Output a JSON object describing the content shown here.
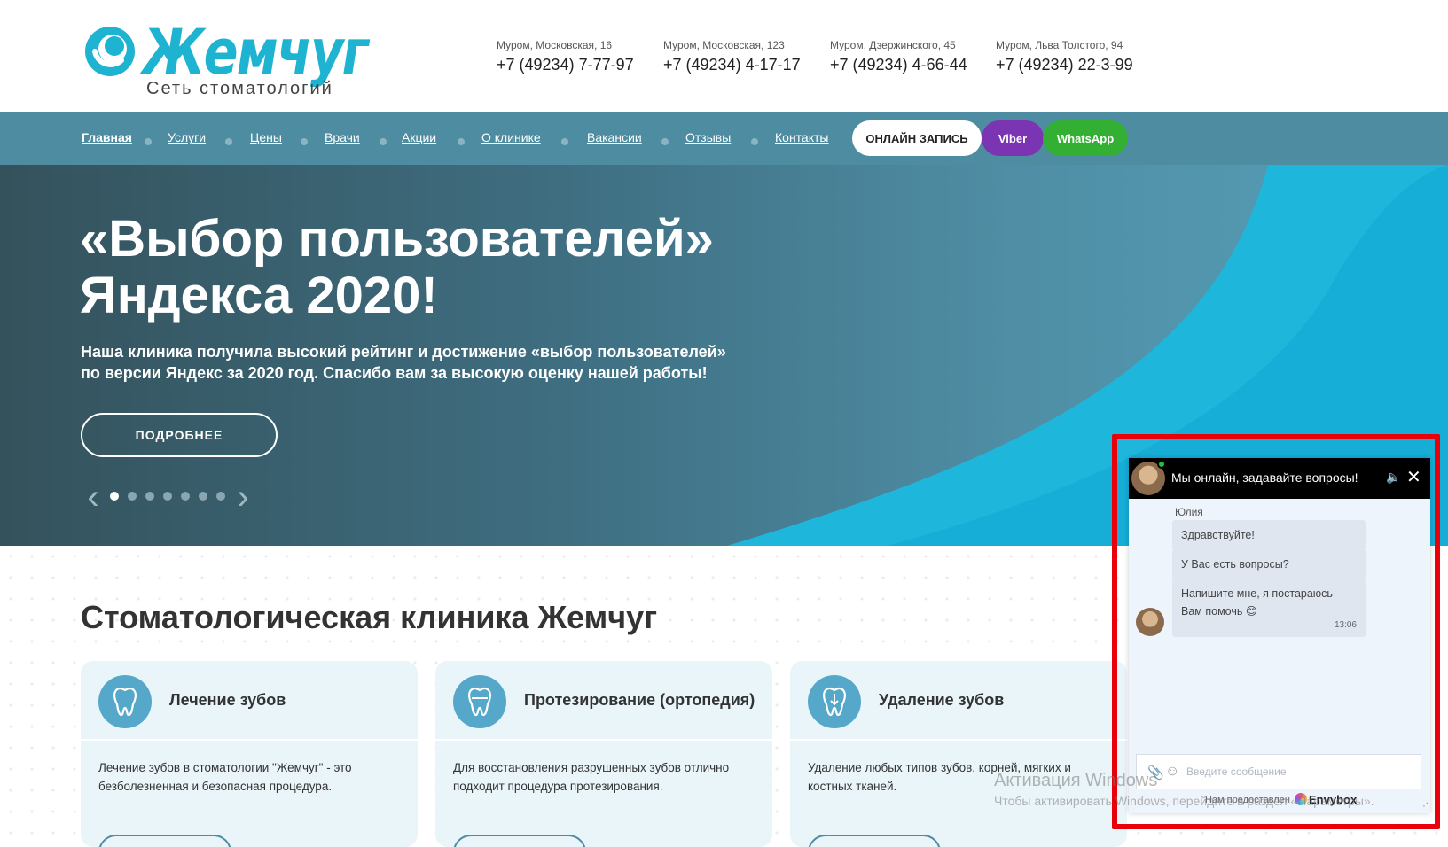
{
  "header": {
    "logo_title": "Жемчуг",
    "logo_subtitle": "Сеть стоматологий",
    "addresses": [
      {
        "address": "Муром, Московская, 16",
        "phone": "+7 (49234) 7-77-97"
      },
      {
        "address": "Муром, Московская, 123",
        "phone": "+7 (49234) 4-17-17"
      },
      {
        "address": "Муром, Дзержинского, 45",
        "phone": "+7 (49234) 4-66-44"
      },
      {
        "address": "Муром, Льва Толстого, 94",
        "phone": "+7 (49234) 22-3-99"
      }
    ]
  },
  "nav": {
    "items": [
      {
        "label": "Главная"
      },
      {
        "label": "Услуги"
      },
      {
        "label": "Цены"
      },
      {
        "label": "Врачи"
      },
      {
        "label": "Акции"
      },
      {
        "label": "О клинике"
      },
      {
        "label": "Вакансии"
      },
      {
        "label": "Отзывы"
      },
      {
        "label": "Контакты"
      }
    ],
    "online_booking": "ОНЛАЙН ЗАПИСЬ",
    "viber": "Viber",
    "whatsapp": "WhatsApp"
  },
  "hero": {
    "title": "«Выбор пользователей» Яндекса 2020!",
    "text": "Наша клиника получила высокий рейтинг и достижение «выбор пользователей» по версии Яндекс за 2020 год. Спасибо вам за высокую оценку нашей работы!",
    "button": "ПОДРОБНЕЕ",
    "slides_total": 7,
    "slide_active": 1,
    "prev_icon": "‹",
    "next_icon": "›"
  },
  "main": {
    "section_title": "Стоматологическая клиника Жемчуг",
    "cards": [
      {
        "title": "Лечение зубов",
        "text": "Лечение зубов в стоматологии \"Жемчуг\" - это безболезненная и безопасная процедура.",
        "icon": "tooth-icon"
      },
      {
        "title": "Протезирование (ортопедия)",
        "text": "Для восстановления разрушенных зубов отлично подходит процедура протезирования.",
        "icon": "tooth-crown-icon"
      },
      {
        "title": "Удаление зубов",
        "text": "Удаление любых типов зубов, корней, мягких и костных тканей.",
        "icon": "tooth-extraction-icon"
      }
    ]
  },
  "chat": {
    "header_title": "Мы онлайн, задавайте вопросы!",
    "agent_name": "Юлия",
    "messages": [
      {
        "text": "Здравствуйте!"
      },
      {
        "text": "У Вас есть вопросы?"
      },
      {
        "text": "Напишите мне, я постараюсь Вам помочь 😊",
        "time": "13:06"
      }
    ],
    "input_placeholder": "Введите сообщение",
    "powered_by": "Нам предоставлен",
    "brand": "Envybox"
  },
  "watermark": {
    "line1": "Активация Windows",
    "line2": "Чтобы активировать Windows, перейдите в раздел «Параметры»."
  },
  "colors": {
    "brand": "#1fb3d2",
    "nav_bg": "#4d8ca1",
    "viber": "#7b35b3",
    "whatsapp": "#33b033",
    "highlight": "#e8000a"
  }
}
